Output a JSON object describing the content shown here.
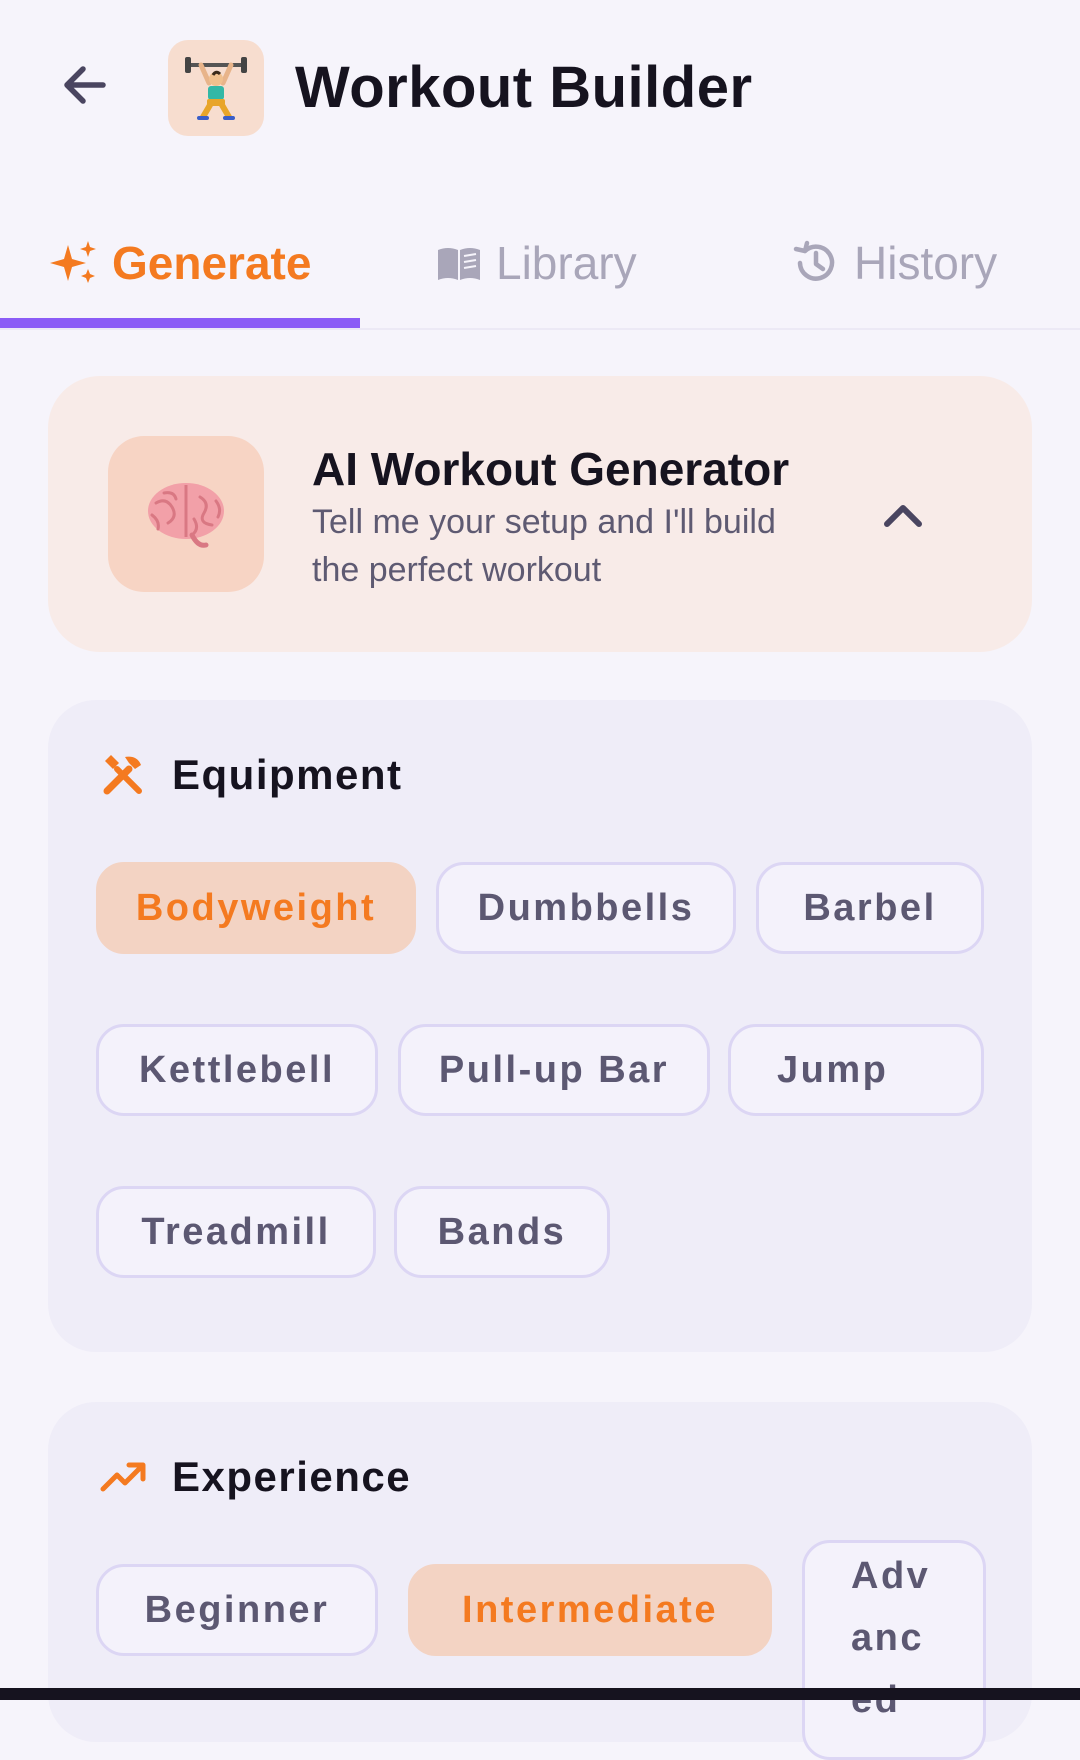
{
  "header": {
    "title": "Workout Builder",
    "back_icon": "arrow-left-icon",
    "app_icon": "weightlifter-icon"
  },
  "tabs": [
    {
      "label": "Generate",
      "icon": "sparkles-icon",
      "active": true
    },
    {
      "label": "Library",
      "icon": "open-book-icon",
      "active": false
    },
    {
      "label": "History",
      "icon": "history-icon",
      "active": false
    }
  ],
  "ai_generator": {
    "title": "AI Workout Generator",
    "subtitle": "Tell me your setup and I'll build the perfect workout",
    "icon": "brain-icon",
    "expanded": true
  },
  "equipment": {
    "title": "Equipment",
    "icon": "tools-icon",
    "options": [
      {
        "label": "Bodyweight",
        "selected": true
      },
      {
        "label": "Dumbbells",
        "selected": false
      },
      {
        "label": "Barbel",
        "selected": false
      },
      {
        "label": "Kettlebell",
        "selected": false
      },
      {
        "label": "Pull-up Bar",
        "selected": false
      },
      {
        "label": "Jump",
        "selected": false
      },
      {
        "label": "Treadmill",
        "selected": false
      },
      {
        "label": "Bands",
        "selected": false
      }
    ]
  },
  "experience": {
    "title": "Experience",
    "icon": "trending-up-icon",
    "options": [
      {
        "label": "Beginner",
        "selected": false
      },
      {
        "label": "Intermediate",
        "selected": true
      },
      {
        "label": "Advanced",
        "selected": false,
        "display": "Adv anc ed"
      }
    ]
  },
  "colors": {
    "accent_orange": "#f47a20",
    "accent_purple": "#8b5cf6",
    "chip_selected_bg": "#f3d3c3",
    "chip_border": "#dcd6f4",
    "background": "#f6f4fb"
  }
}
